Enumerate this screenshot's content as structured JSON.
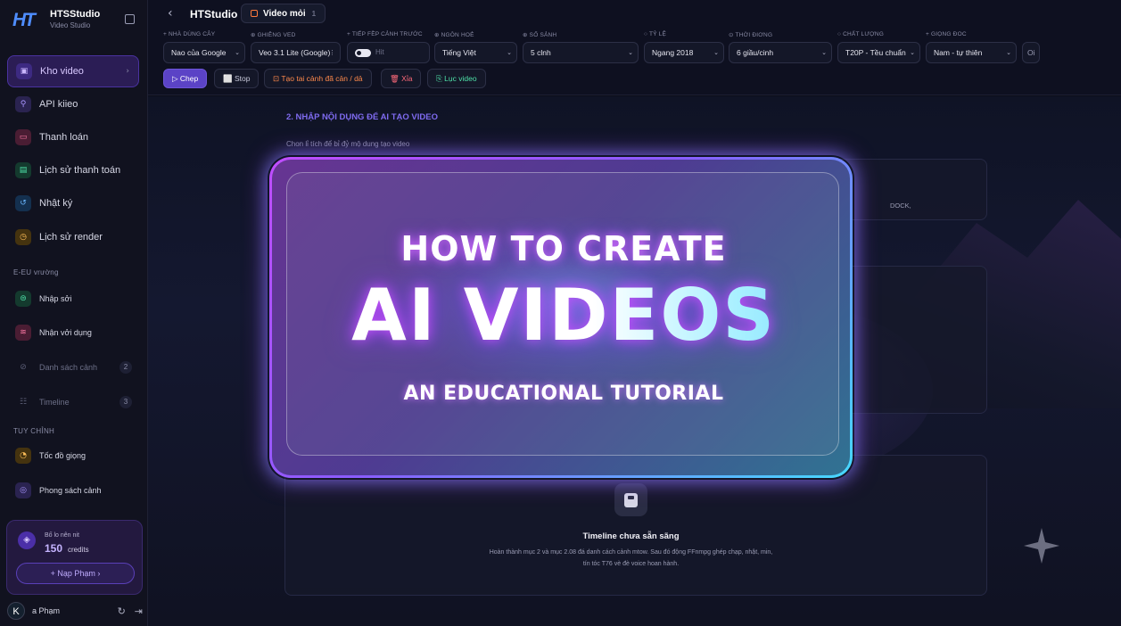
{
  "sidebar": {
    "brand_name": "HTSStudio",
    "brand_sub": "Video Studio",
    "nav": [
      {
        "label": "Kho video",
        "icon": "film-icon",
        "color": "#7c5cff"
      },
      {
        "label": "API kiieo",
        "icon": "key-icon",
        "color": "#7c5cff"
      },
      {
        "label": "Thanh loán",
        "icon": "card-icon",
        "color": "#e0457b"
      },
      {
        "label": "Lịch sử thanh toán",
        "icon": "receipt-icon",
        "color": "#22c08a"
      },
      {
        "label": "Nhật ký",
        "icon": "history-icon",
        "color": "#3b9cff"
      },
      {
        "label": "Lịch sử render",
        "icon": "render-icon",
        "color": "#f0a020"
      }
    ],
    "section1_label": "E-EU vrường",
    "nav2": [
      {
        "label": "Nhập sởi",
        "icon": "import-icon",
        "color": "#22c08a"
      },
      {
        "label": "Nhận vởi dụng",
        "icon": "scene-icon",
        "color": "#e0457b"
      },
      {
        "label": "Danh sách cảnh",
        "icon": "list-icon",
        "badge": "2"
      },
      {
        "label": "Timeline",
        "icon": "timeline-icon",
        "badge": "3"
      }
    ],
    "section2_label": "TUY CHỈNH",
    "nav3": [
      {
        "label": "Tốc đồ giọng",
        "icon": "speed-icon",
        "color": "#f0a020"
      },
      {
        "label": "Phong sách cảnh",
        "icon": "style-icon",
        "color": "#7c5cff"
      }
    ],
    "credits": {
      "label": "Bố lo nên nit",
      "value": "150",
      "unit": "credits",
      "button": "+ Nạp Phạm ›"
    },
    "user": {
      "initial": "K",
      "name": "a Phạm"
    }
  },
  "topbar": {
    "title": "HTStudio",
    "tab_label": "Video mỏi",
    "tab_count": "1",
    "fields": [
      {
        "label": "+ NHÀ DÙNG CÂY",
        "value": "Nao của Google"
      },
      {
        "label": "⊕ GHIÊNG VED",
        "value": "Veo 3.1 Lite (Google)"
      },
      {
        "label": "+ TIẾP FỀP CẢNH TRƯỚC",
        "value": "Hit"
      },
      {
        "label": "⊕ NGÔN HOẺ",
        "value": "Tiếng Việt"
      },
      {
        "label": "⊕ SỐ SẢNH",
        "value": "5 clnh"
      },
      {
        "label": "○ TỶ LỆ",
        "value": "Ngang 2018"
      },
      {
        "label": "⊙ THỜI ĐIƠNG",
        "value": "6 giầu/cinh"
      },
      {
        "label": "○ CHẤT LƯỢNG",
        "value": "T20P - Tều chuẩn"
      },
      {
        "label": "+ GIỌNG ĐOC",
        "value": "Nam - tự thiên"
      }
    ],
    "extra_button": "Oi",
    "actions": [
      {
        "label": "▷ Chẹp"
      },
      {
        "label": "⬜ Stop"
      },
      {
        "label": "⊡ Tạo tai cảnh đã cản / dả"
      },
      {
        "label": "🗑 Xỉa"
      },
      {
        "label": "⎘ Lục video"
      }
    ]
  },
  "main": {
    "section_title": "2. NHẬP NỘI DỤNG ĐỂ AI TẠO VIDEO",
    "section_desc": "Chon lỉ tích để bỉ đỷ mộ dung tạo video",
    "panel_hint": "DOCK,",
    "timeline_title": "Timeline chưa sẵn sãng",
    "timeline_desc": "Hoàn thành mục 2 và mục 2.08 đá danh cách cảnh mtow. Sau đó động FFnmpg ghép chạp, nhật, min, tín tóc T76 vè đè voice hoan hành."
  },
  "overlay": {
    "line1": "HOW TO CREATE",
    "line2": "AI VIDEOS",
    "line3": "AN EDUCATIONAL TUTORIAL"
  }
}
